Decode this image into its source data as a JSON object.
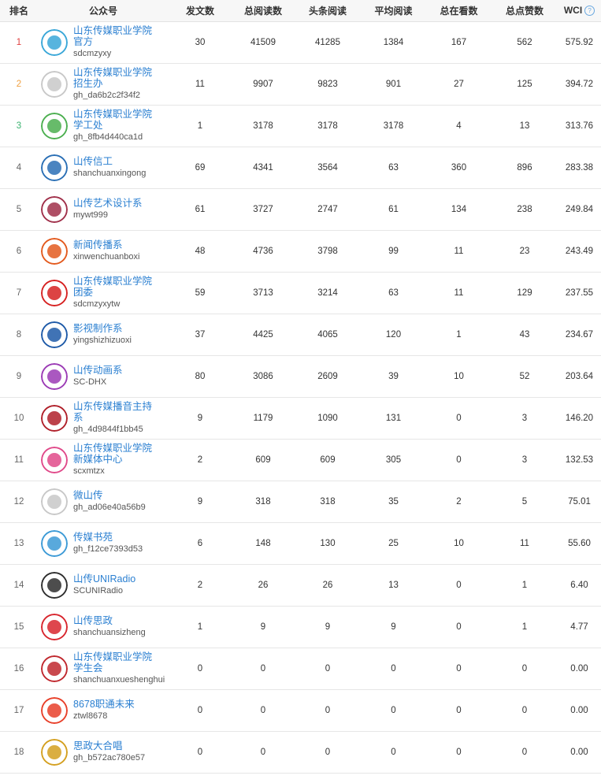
{
  "headers": {
    "rank": "排名",
    "account": "公众号",
    "posts": "发文数",
    "total_reads": "总阅读数",
    "headline_reads": "头条阅读",
    "avg_reads": "平均阅读",
    "total_watching": "总在看数",
    "total_likes": "总点赞数",
    "wci": "WCI",
    "wci_help_icon": "question-circle-icon"
  },
  "rows": [
    {
      "rank": "1",
      "name": "山东传媒职业学院官方",
      "id": "sdcmzyxy",
      "posts": "30",
      "total_reads": "41509",
      "headline_reads": "41285",
      "avg_reads": "1384",
      "watching": "167",
      "likes": "562",
      "wci": "575.92",
      "logo_color": "#3aa7d8"
    },
    {
      "rank": "2",
      "name": "山东传媒职业学院招生办",
      "id": "gh_da6b2c2f34f2",
      "posts": "11",
      "total_reads": "9907",
      "headline_reads": "9823",
      "avg_reads": "901",
      "watching": "27",
      "likes": "125",
      "wci": "394.72",
      "logo_color": "#c8c8c8"
    },
    {
      "rank": "3",
      "name": "山东传媒职业学院学工处",
      "id": "gh_8fb4d440ca1d",
      "posts": "1",
      "total_reads": "3178",
      "headline_reads": "3178",
      "avg_reads": "3178",
      "watching": "4",
      "likes": "13",
      "wci": "313.76",
      "logo_color": "#4caf50"
    },
    {
      "rank": "4",
      "name": "山传信工",
      "id": "shanchuanxingong",
      "posts": "69",
      "total_reads": "4341",
      "headline_reads": "3564",
      "avg_reads": "63",
      "watching": "360",
      "likes": "896",
      "wci": "283.38",
      "logo_color": "#2a6fb5"
    },
    {
      "rank": "5",
      "name": "山传艺术设计系",
      "id": "mywt999",
      "posts": "61",
      "total_reads": "3727",
      "headline_reads": "2747",
      "avg_reads": "61",
      "watching": "134",
      "likes": "238",
      "wci": "249.84",
      "logo_color": "#a0304a"
    },
    {
      "rank": "6",
      "name": "新闻传播系",
      "id": "xinwenchuanboxi",
      "posts": "48",
      "total_reads": "4736",
      "headline_reads": "3798",
      "avg_reads": "99",
      "watching": "11",
      "likes": "23",
      "wci": "243.49",
      "logo_color": "#e35a1e"
    },
    {
      "rank": "7",
      "name": "山东传媒职业学院团委",
      "id": "sdcmzyxytw",
      "posts": "59",
      "total_reads": "3713",
      "headline_reads": "3214",
      "avg_reads": "63",
      "watching": "11",
      "likes": "129",
      "wci": "237.55",
      "logo_color": "#d62222"
    },
    {
      "rank": "8",
      "name": "影视制作系",
      "id": "yingshizhizuoxi",
      "posts": "37",
      "total_reads": "4425",
      "headline_reads": "4065",
      "avg_reads": "120",
      "watching": "1",
      "likes": "43",
      "wci": "234.67",
      "logo_color": "#1e5aa8"
    },
    {
      "rank": "9",
      "name": "山传动画系",
      "id": "SC-DHX",
      "posts": "80",
      "total_reads": "3086",
      "headline_reads": "2609",
      "avg_reads": "39",
      "watching": "10",
      "likes": "52",
      "wci": "203.64",
      "logo_color": "#9b3bb5"
    },
    {
      "rank": "10",
      "name": "山东传媒播音主持系",
      "id": "gh_4d9844f1bb45",
      "posts": "9",
      "total_reads": "1179",
      "headline_reads": "1090",
      "avg_reads": "131",
      "watching": "0",
      "likes": "3",
      "wci": "146.20",
      "logo_color": "#b0202a"
    },
    {
      "rank": "11",
      "name": "山东传媒职业学院新媒体中心",
      "id": "scxmtzx",
      "posts": "2",
      "total_reads": "609",
      "headline_reads": "609",
      "avg_reads": "305",
      "watching": "0",
      "likes": "3",
      "wci": "132.53",
      "logo_color": "#e04a8a"
    },
    {
      "rank": "12",
      "name": "微山传",
      "id": "gh_ad06e40a56b9",
      "posts": "9",
      "total_reads": "318",
      "headline_reads": "318",
      "avg_reads": "35",
      "watching": "2",
      "likes": "5",
      "wci": "75.01",
      "logo_color": "#c8c8c8"
    },
    {
      "rank": "13",
      "name": "传媒书苑",
      "id": "gh_f12ce7393d53",
      "posts": "6",
      "total_reads": "148",
      "headline_reads": "130",
      "avg_reads": "25",
      "watching": "10",
      "likes": "11",
      "wci": "55.60",
      "logo_color": "#3c9ad6"
    },
    {
      "rank": "14",
      "name": "山传UNIRadio",
      "id": "SCUNIRadio",
      "posts": "2",
      "total_reads": "26",
      "headline_reads": "26",
      "avg_reads": "13",
      "watching": "0",
      "likes": "1",
      "wci": "6.40",
      "logo_color": "#2e2e2e"
    },
    {
      "rank": "15",
      "name": "山传思政",
      "id": "shanchuansizheng",
      "posts": "1",
      "total_reads": "9",
      "headline_reads": "9",
      "avg_reads": "9",
      "watching": "0",
      "likes": "1",
      "wci": "4.77",
      "logo_color": "#d8262e"
    },
    {
      "rank": "16",
      "name": "山东传媒职业学院学生会",
      "id": "shanchuanxueshenghui",
      "posts": "0",
      "total_reads": "0",
      "headline_reads": "0",
      "avg_reads": "0",
      "watching": "0",
      "likes": "0",
      "wci": "0.00",
      "logo_color": "#c0282e"
    },
    {
      "rank": "17",
      "name": "8678职通未来",
      "id": "ztwl8678",
      "posts": "0",
      "total_reads": "0",
      "headline_reads": "0",
      "avg_reads": "0",
      "watching": "0",
      "likes": "0",
      "wci": "0.00",
      "logo_color": "#e8402a"
    },
    {
      "rank": "18",
      "name": "思政大合唱",
      "id": "gh_b572ac780e57",
      "posts": "0",
      "total_reads": "0",
      "headline_reads": "0",
      "avg_reads": "0",
      "watching": "0",
      "likes": "0",
      "wci": "0.00",
      "logo_color": "#d4a020"
    }
  ]
}
